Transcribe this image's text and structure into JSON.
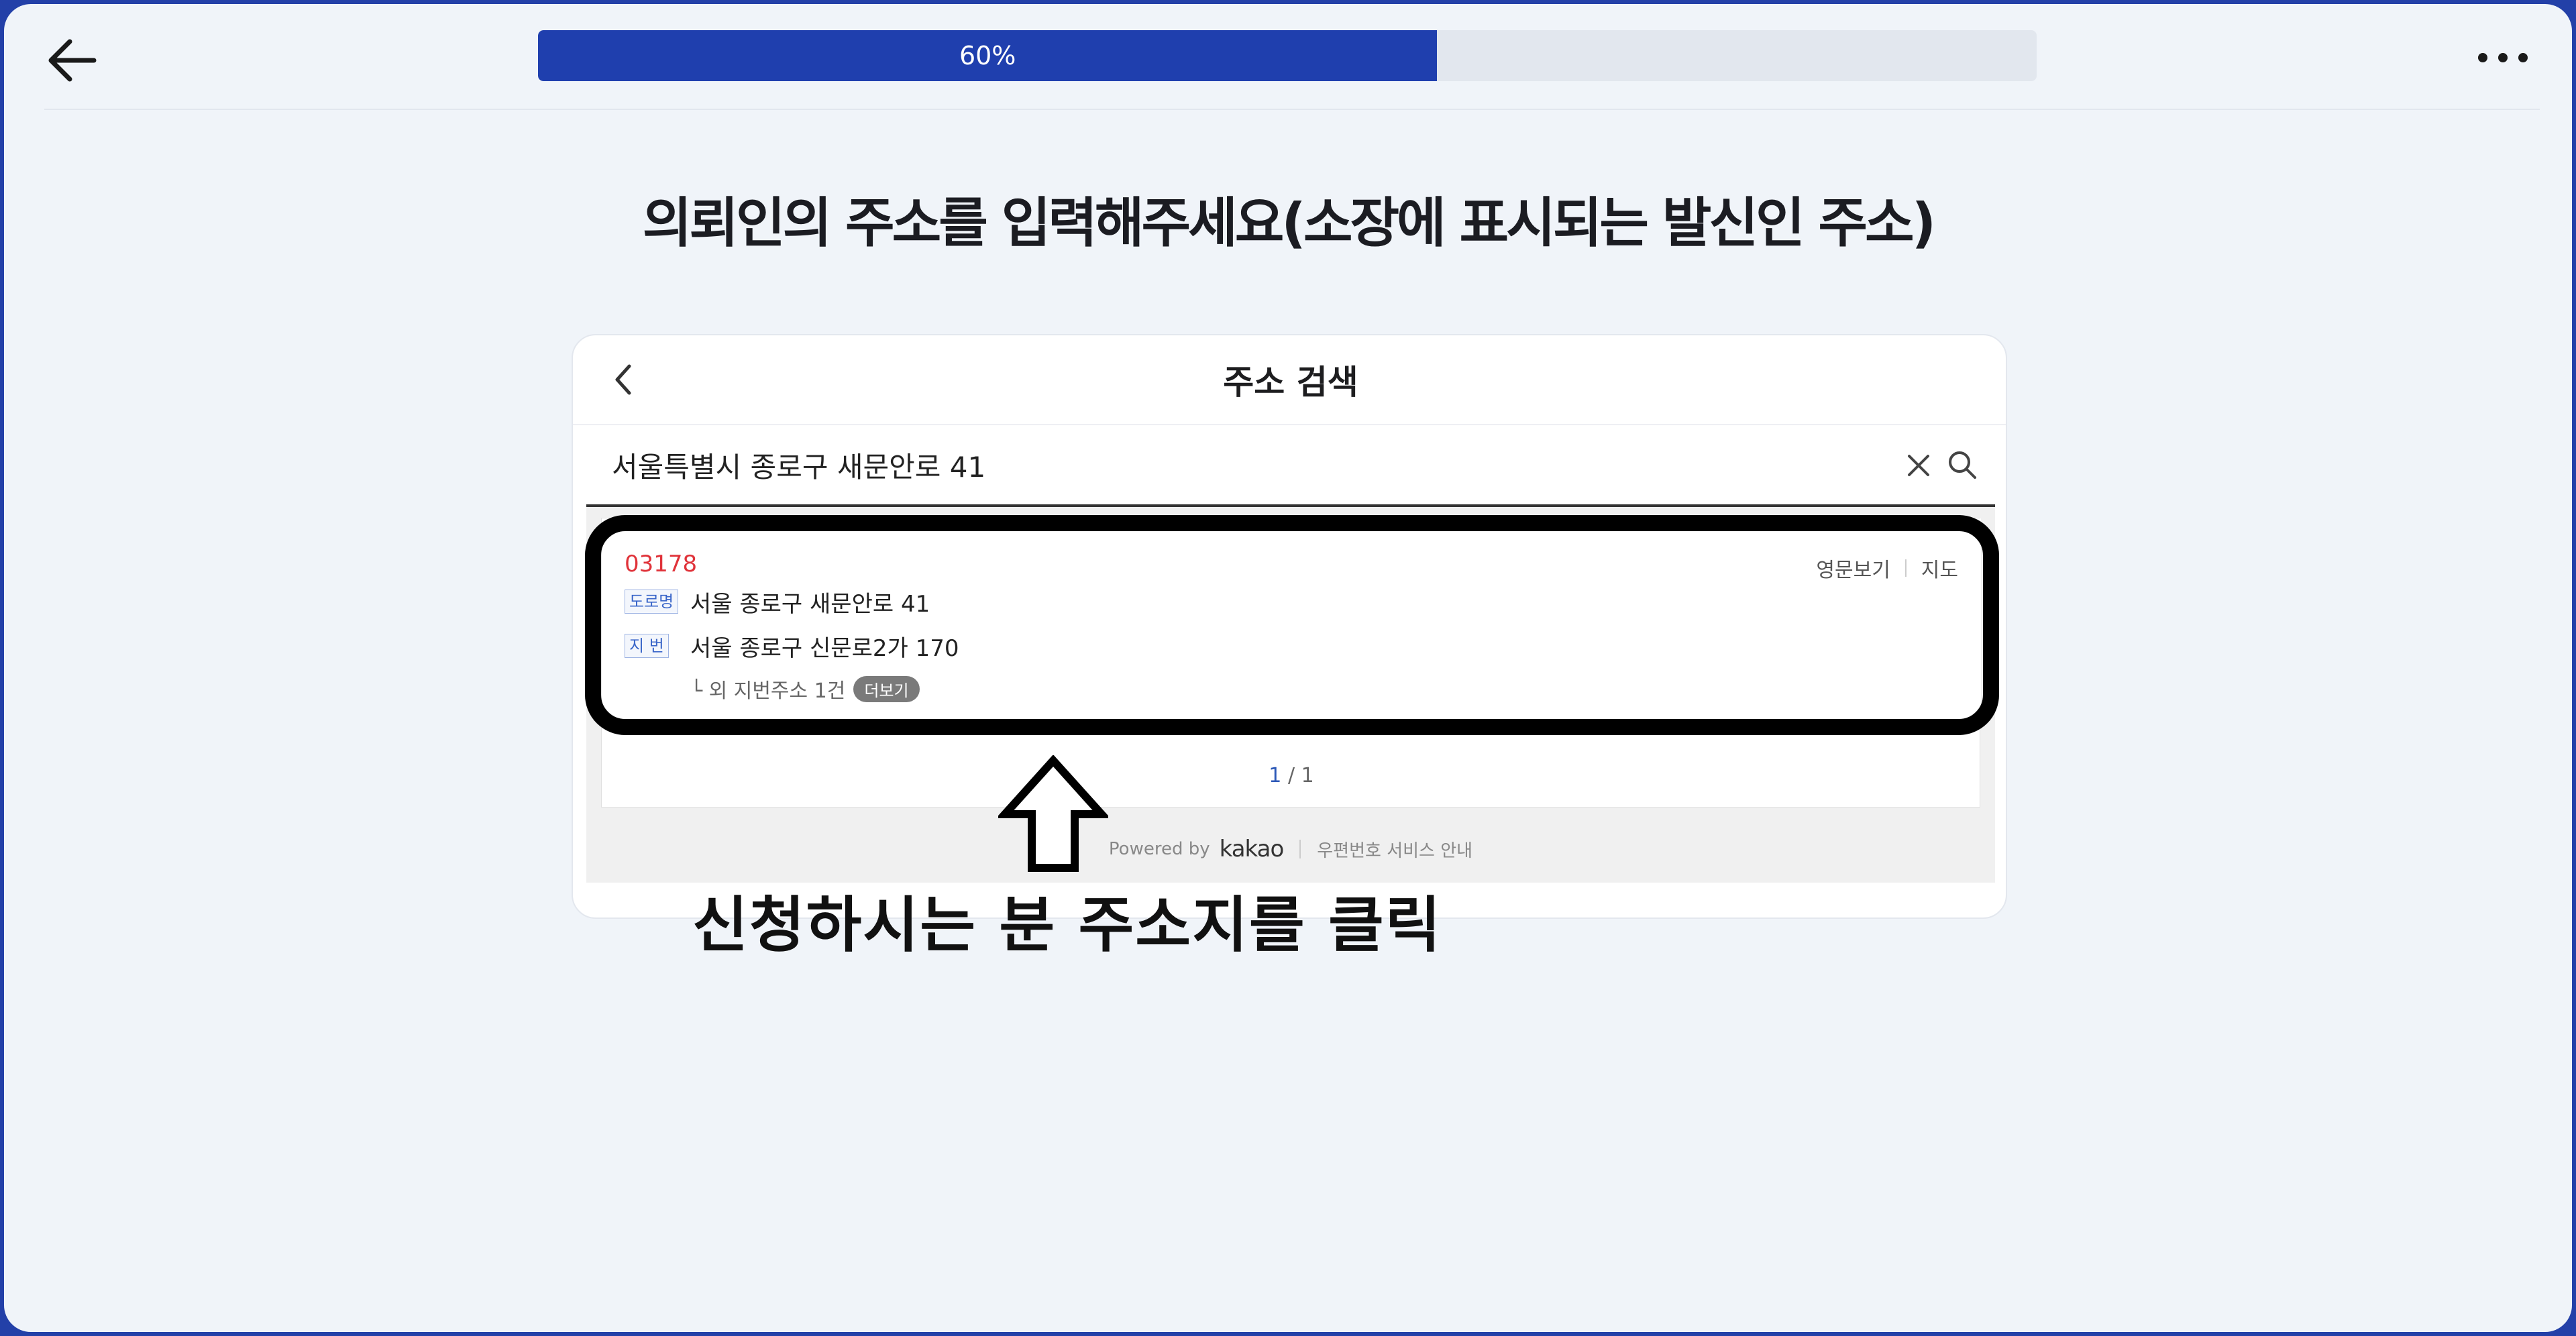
{
  "progress": {
    "label": "60%",
    "value": 0.6
  },
  "page": {
    "title": "의뢰인의 주소를 입력해주세요(소장에 표시되는 발신인 주소)"
  },
  "address_search": {
    "title": "주소 검색",
    "query": "서울특별시 종로구 새문안로 41",
    "result": {
      "zip": "03178",
      "road_tag": "도로명",
      "road_address": "서울 종로구 새문안로 41",
      "jibun_tag": "지 번",
      "jibun_address": "서울 종로구 신문로2가 170",
      "more_text": "└ 외 지번주소 1건",
      "more_badge": "더보기",
      "link_english": "영문보기",
      "link_map": "지도"
    },
    "pager": {
      "current": "1",
      "separator": "/",
      "total": "1"
    },
    "footer": {
      "powered_by": "Powered by",
      "brand": "kakao",
      "service_info": "우편번호 서비스 안내"
    }
  },
  "instruction": "신청하시는 분 주소지를 클릭",
  "colors": {
    "accent": "#1f3fae",
    "zip": "#e0333a",
    "frame": "#2340a8"
  }
}
